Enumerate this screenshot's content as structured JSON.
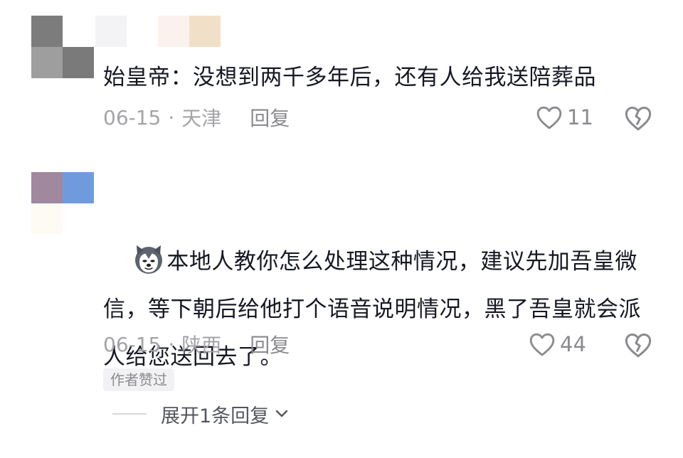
{
  "comments": [
    {
      "text": "始皇帝：没想到两千多年后，还有人给我送陪葬品",
      "date": "06-15",
      "location": "天津",
      "reply_label": "回复",
      "likes": "11",
      "like_icon": "heart-outline-icon",
      "dislike_icon": "broken-heart-icon"
    },
    {
      "emoji_icon": "husky-dog-emoji-icon",
      "text": "本地人教你怎么处理这种情况，建议先加吾皇微信，等下朝后给他打个语音说明情况，黑了吾皇就会派人给您送回去了。",
      "date": "06-15",
      "location": "陕西",
      "reply_label": "回复",
      "likes": "44",
      "like_icon": "heart-outline-icon",
      "dislike_icon": "broken-heart-icon",
      "author_liked_badge": "作者赞过",
      "expand_label": "展开1条回复",
      "expand_icon": "chevron-down-icon"
    }
  ],
  "colors": {
    "text_primary": "#161823",
    "text_secondary": "#a3a3a8",
    "text_action": "#8a8a8f"
  }
}
